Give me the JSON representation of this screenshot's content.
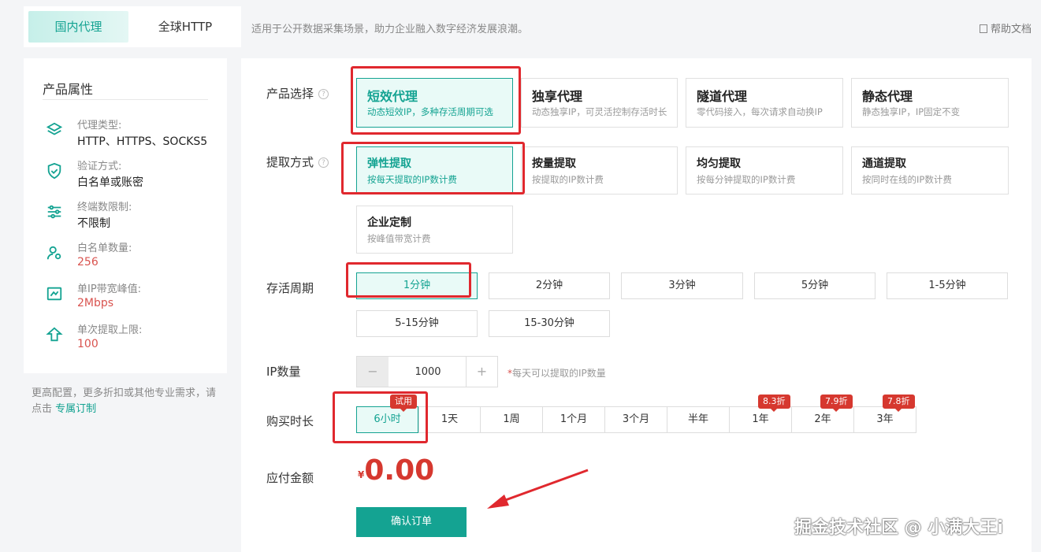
{
  "top_tabs": [
    {
      "label": "国内代理",
      "active": true
    },
    {
      "label": "全球HTTP",
      "active": false
    }
  ],
  "top_description": "适用于公开数据采集场景，助力企业融入数字经济发展浪潮。",
  "help_doc": "帮助文档",
  "left_panel": {
    "title": "产品属性",
    "attributes": [
      {
        "icon": "layers-icon",
        "label": "代理类型:",
        "value": "HTTP、HTTPS、SOCKS5"
      },
      {
        "icon": "shield-icon",
        "label": "验证方式:",
        "value": "白名单或账密"
      },
      {
        "icon": "sliders-icon",
        "label": "终端数限制:",
        "value": "不限制"
      },
      {
        "icon": "user-settings-icon",
        "label": "白名单数量:",
        "value": "256"
      },
      {
        "icon": "bandwidth-icon",
        "label": "单IP带宽峰值:",
        "value": "2Mbps"
      },
      {
        "icon": "upload-icon",
        "label": "单次提取上限:",
        "value": "100"
      }
    ],
    "note_prefix": "更高配置，更多折扣或其他专业需求，请点击 ",
    "note_link": "专属订制"
  },
  "product": {
    "label": "产品选择",
    "options": [
      {
        "title": "短效代理",
        "desc": "动态短效IP，多种存活周期可选",
        "selected": true
      },
      {
        "title": "独享代理",
        "desc": "动态独享IP，可灵活控制存活时长"
      },
      {
        "title": "隧道代理",
        "desc": "零代码接入，每次请求自动换IP"
      },
      {
        "title": "静态代理",
        "desc": "静态独享IP，IP固定不变"
      }
    ]
  },
  "extraction": {
    "label": "提取方式",
    "options": [
      {
        "title": "弹性提取",
        "desc": "按每天提取的IP数计费",
        "selected": true
      },
      {
        "title": "按量提取",
        "desc": "按提取的IP数计费"
      },
      {
        "title": "均匀提取",
        "desc": "按每分钟提取的IP数计费"
      },
      {
        "title": "通道提取",
        "desc": "按同时在线的IP数计费"
      },
      {
        "title": "企业定制",
        "desc": "按峰值带宽计费"
      }
    ]
  },
  "lifetime": {
    "label": "存活周期",
    "options": [
      "1分钟",
      "2分钟",
      "3分钟",
      "5分钟",
      "1-5分钟",
      "5-15分钟",
      "15-30分钟"
    ],
    "selected_index": 0
  },
  "ip_count": {
    "label": "IP数量",
    "minus": "−",
    "value": "1000",
    "plus": "+",
    "note_star": "*",
    "note": "每天可以提取的IP数量"
  },
  "duration": {
    "label": "购买时长",
    "options": [
      {
        "label": "6小时",
        "badge": "试用"
      },
      {
        "label": "1天",
        "badge": ""
      },
      {
        "label": "1周",
        "badge": ""
      },
      {
        "label": "1个月",
        "badge": ""
      },
      {
        "label": "3个月",
        "badge": ""
      },
      {
        "label": "半年",
        "badge": ""
      },
      {
        "label": "1年",
        "badge": "8.3折"
      },
      {
        "label": "2年",
        "badge": "7.9折"
      },
      {
        "label": "3年",
        "badge": "7.8折"
      }
    ],
    "selected_index": 0
  },
  "payment": {
    "label": "应付金额",
    "currency": "¥",
    "amount": "0.00"
  },
  "confirm_button": "确认订单",
  "watermark": "掘金技术社区 @ 小满大王i",
  "colors": {
    "accent": "#14a392",
    "selected_bg": "#e9faf7",
    "highlight": "#e0282e",
    "price": "#d6382f"
  }
}
